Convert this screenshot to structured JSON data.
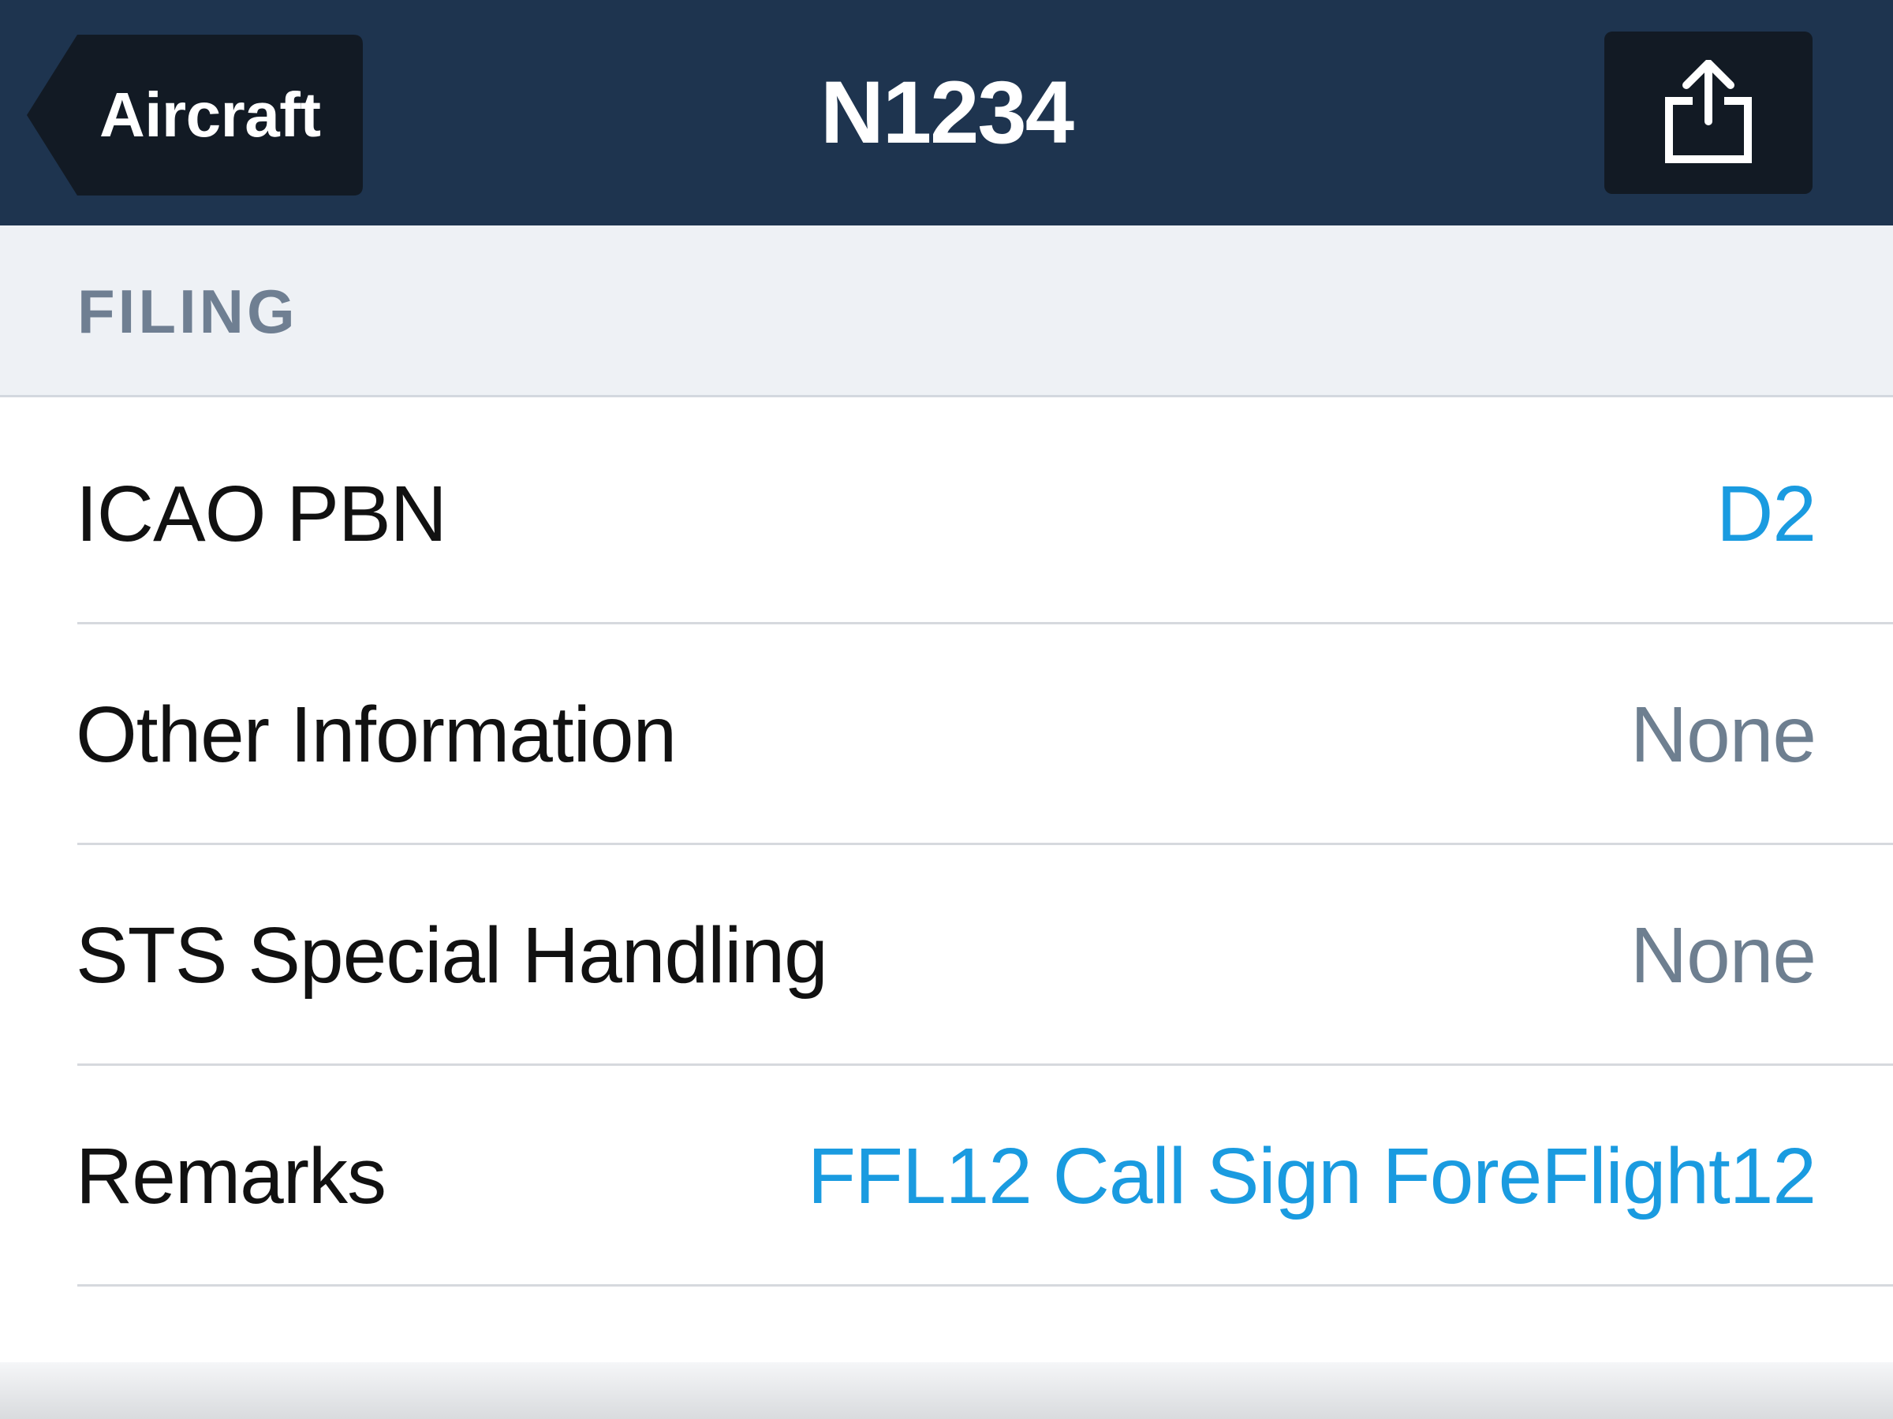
{
  "navbar": {
    "back_label": "Aircraft",
    "title": "N1234",
    "share_icon": "share-icon"
  },
  "section": {
    "title": "FILING"
  },
  "rows": [
    {
      "label": "ICAO PBN",
      "value": "D2",
      "value_color": "#1a9be0"
    },
    {
      "label": "Other Information",
      "value": "None",
      "value_color": "#6e7f90"
    },
    {
      "label": "STS Special Handling",
      "value": "None",
      "value_color": "#6e7f90"
    },
    {
      "label": "Remarks",
      "value": "FFL12 Call Sign ForeFlight12",
      "value_color": "#1a9be0"
    }
  ],
  "colors": {
    "navbar_bg": "#1e344f",
    "button_bg": "#121a24",
    "section_bg": "#eef1f5",
    "accent_blue": "#1a9be0",
    "muted_gray": "#6e7f90"
  }
}
